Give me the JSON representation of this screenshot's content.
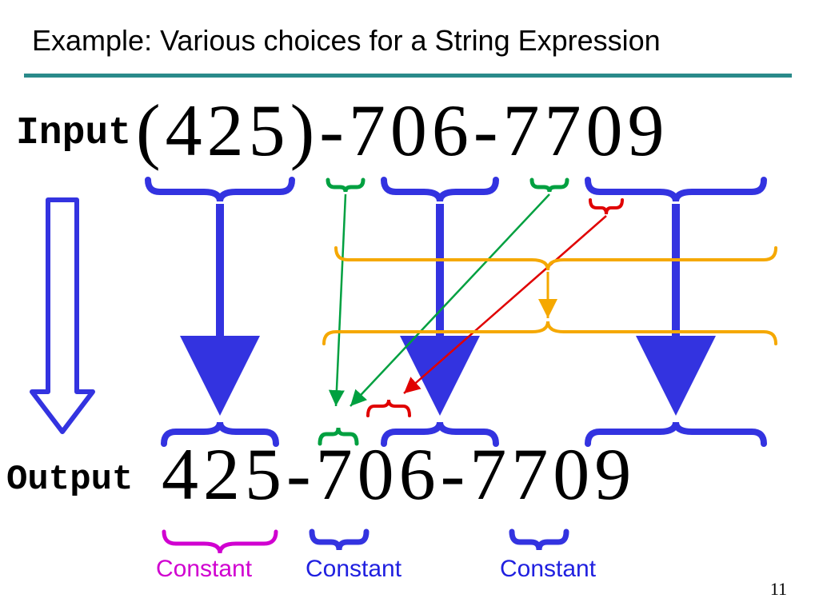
{
  "title": "Example: Various choices for a String Expression",
  "input_label": "Input",
  "output_label": "Output",
  "input_text": "(425)-706-7709",
  "output_text": "425-706-7709",
  "constant_label_magenta": "Constant",
  "constant_label_blue_1": "Constant",
  "constant_label_blue_2": "Constant",
  "page_number": "11",
  "chart_data": {
    "type": "diagram",
    "elements": {
      "input_string": "(425)-706-7709",
      "output_string": "425-706-7709",
      "mappings": [
        {
          "source_substr": "(425)",
          "target_substr": "425",
          "color": "blue",
          "kind": "extract"
        },
        {
          "source_substr": "-",
          "target_substr": "-",
          "color": "green",
          "kind": "dash-copy-1"
        },
        {
          "source_substr": "706",
          "target_substr": "706",
          "color": "blue",
          "kind": "extract"
        },
        {
          "source_substr": "-",
          "target_substr": "-",
          "color": "green",
          "kind": "dash-copy-2"
        },
        {
          "source_substr": "7",
          "target_substr": "-",
          "color": "red",
          "kind": "alt-mapping"
        },
        {
          "source_substr": "7709",
          "target_substr": "7709",
          "color": "blue",
          "kind": "extract"
        },
        {
          "source_substr": "706-7709",
          "color": "orange",
          "kind": "span-group"
        }
      ],
      "constants": [
        {
          "text": "425",
          "label": "Constant",
          "color": "magenta"
        },
        {
          "text": "-",
          "label": "Constant",
          "color": "blue"
        },
        {
          "text": "-",
          "label": "Constant",
          "color": "blue"
        }
      ]
    }
  }
}
